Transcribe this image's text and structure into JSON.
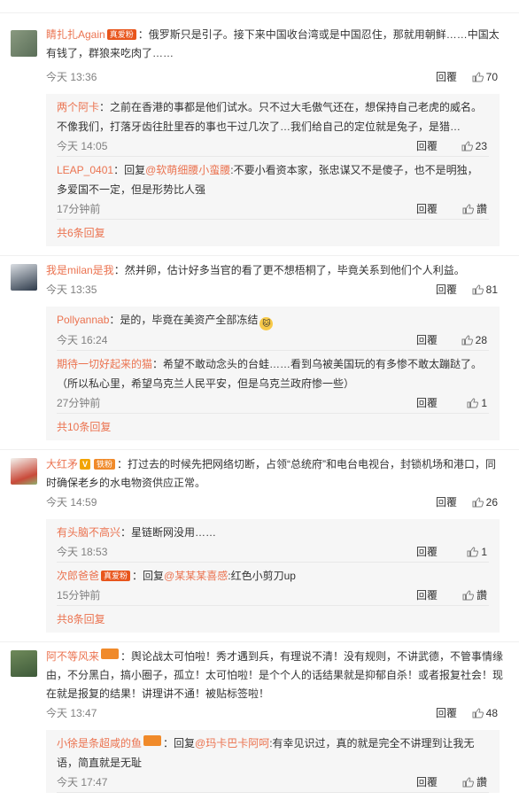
{
  "c1": {
    "user": "睛扎扎Again",
    "badge": "真爱粉",
    "text": "：俄罗斯只是引子。接下来中国收台湾或是中国忍住，那就用朝鲜……中国太有钱了，群狼来吃肉了……",
    "time": "今天 13:36",
    "reply": "回覆",
    "likes": "70",
    "subs": [
      {
        "user": "两个阿卡",
        "text": "：之前在香港的事都是他们试水。只不过大毛傲气还在，想保持自己老虎的威名。不像我们，打落牙齿往肚里吞的事也干过几次了…我们给自己的定位就是兔子，是猎…",
        "time": "今天 14:05",
        "reply": "回覆",
        "likes": "23"
      },
      {
        "user": "LEAP_0401",
        "pre": "：回复",
        "at": "@软萌细腰小蛮腰",
        "text": ":不要小看资本家，张忠谋又不是傻子，也不是明独，多爱国不一定，但是形势比人强",
        "time": "17分钟前",
        "reply": "回覆",
        "likes": "讚"
      }
    ],
    "more": "共6条回复"
  },
  "c2": {
    "user": "我是milan是我",
    "text": "：然并卵，估计好多当官的看了更不想梧桐了，毕竟关系到他们个人利益。",
    "time": "今天 13:35",
    "reply": "回覆",
    "likes": "81",
    "subs": [
      {
        "user": "Pollyannab",
        "text": "：是的，毕竟在美资产全部冻结",
        "emoji": "🐱",
        "time": "今天 16:24",
        "reply": "回覆",
        "likes": "28"
      },
      {
        "user": "期待一切好起来的猫",
        "text": "：希望不敢动念头的台蛙……看到乌被美国玩的有多惨不敢太蹦跶了。（所以私心里，希望乌克兰人民平安，但是乌克兰政府惨一些）",
        "time": "27分钟前",
        "reply": "回覆",
        "likes": "1"
      }
    ],
    "more": "共10条回复"
  },
  "c3": {
    "user": "大红矛",
    "vbadge": "V",
    "badge": "铁粉",
    "text": "：打过去的时候先把网络切断，占领“总统府”和电台电视台，封锁机场和港口，同时确保老乡的水电物资供应正常。",
    "time": "今天 14:59",
    "reply": "回覆",
    "likes": "26",
    "subs": [
      {
        "user": "有头脑不高兴",
        "text": "：星链断网没用……",
        "time": "今天 18:53",
        "reply": "回覆",
        "likes": "1"
      },
      {
        "user": "次郎爸爸",
        "badge": "真爱粉",
        "pre": "：回复",
        "at": "@某某某喜感",
        "text": ":红色小剪刀up",
        "time": "15分钟前",
        "reply": "回覆",
        "likes": "讚"
      }
    ],
    "more": "共8条回复"
  },
  "c4": {
    "user": "阿不等风来",
    "badge": "",
    "text": "：舆论战太可怕啦！秀才遇到兵，有理说不清！没有规则，不讲武德，不管事情缘由，不分黑白，搞小圈子，孤立！太可怕啦！是个个人的话结果就是抑郁自杀！或者报复社会！现在就是报复的结果！讲理讲不通！被贴标签啦！",
    "time": "今天 13:47",
    "reply": "回覆",
    "likes": "48",
    "subs": [
      {
        "user": "小徐是条超咸的鱼",
        "badge": "",
        "pre": "：回复",
        "at": "@玛卡巴卡阿呵",
        "text": ":有幸见识过，真的就是完全不讲理到让我无语，简直就是无耻",
        "time": "今天 17:47",
        "reply": "回覆",
        "likes": "讚"
      }
    ]
  },
  "colors": {
    "accent": "#eb7350",
    "bg_sub": "#f6f6f6"
  }
}
